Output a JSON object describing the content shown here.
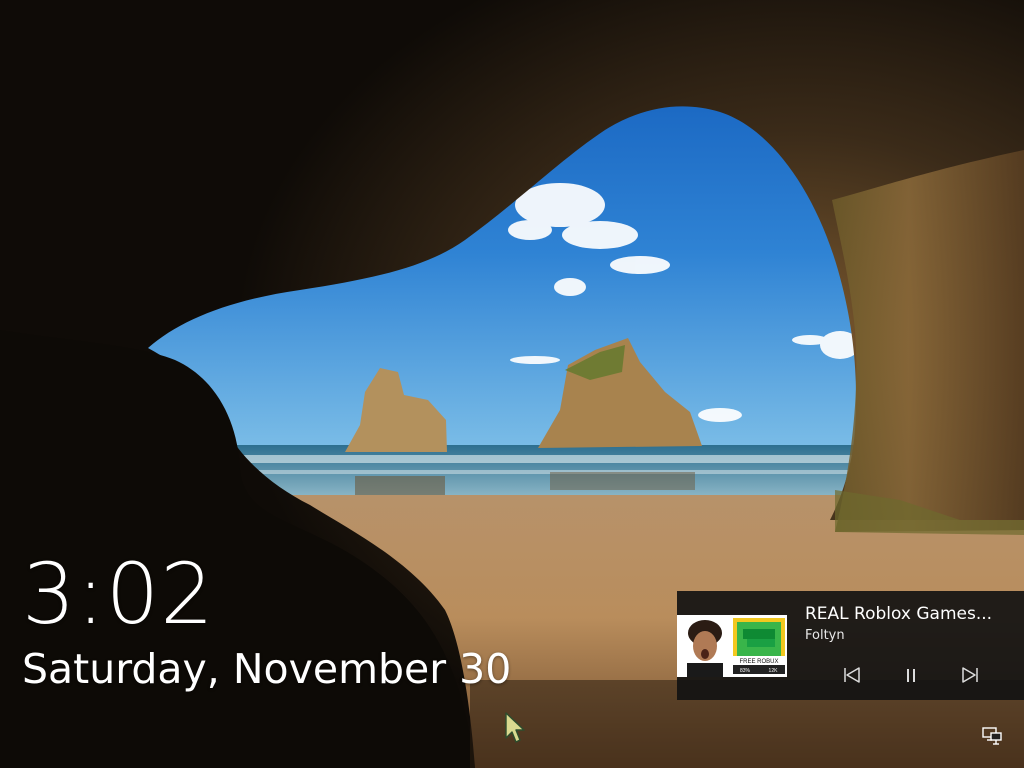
{
  "lock_screen": {
    "time": "3:02",
    "date": "Saturday, November 30"
  },
  "media": {
    "title": "REAL Roblox Games...",
    "artist": "Foltyn",
    "thumbnail_text": {
      "banner": "FREE ROBUX",
      "stat_left": "83%",
      "stat_right": "12K"
    },
    "controls": {
      "previous": "skip-previous-icon",
      "pause": "pause-icon",
      "next": "skip-next-icon"
    }
  },
  "system_tray": {
    "network": "network-icon"
  },
  "colors": {
    "panel": "#121212",
    "text": "#ffffff",
    "sky": "#2f83d4",
    "sand": "#b98d5c",
    "cave": "#17120c"
  }
}
